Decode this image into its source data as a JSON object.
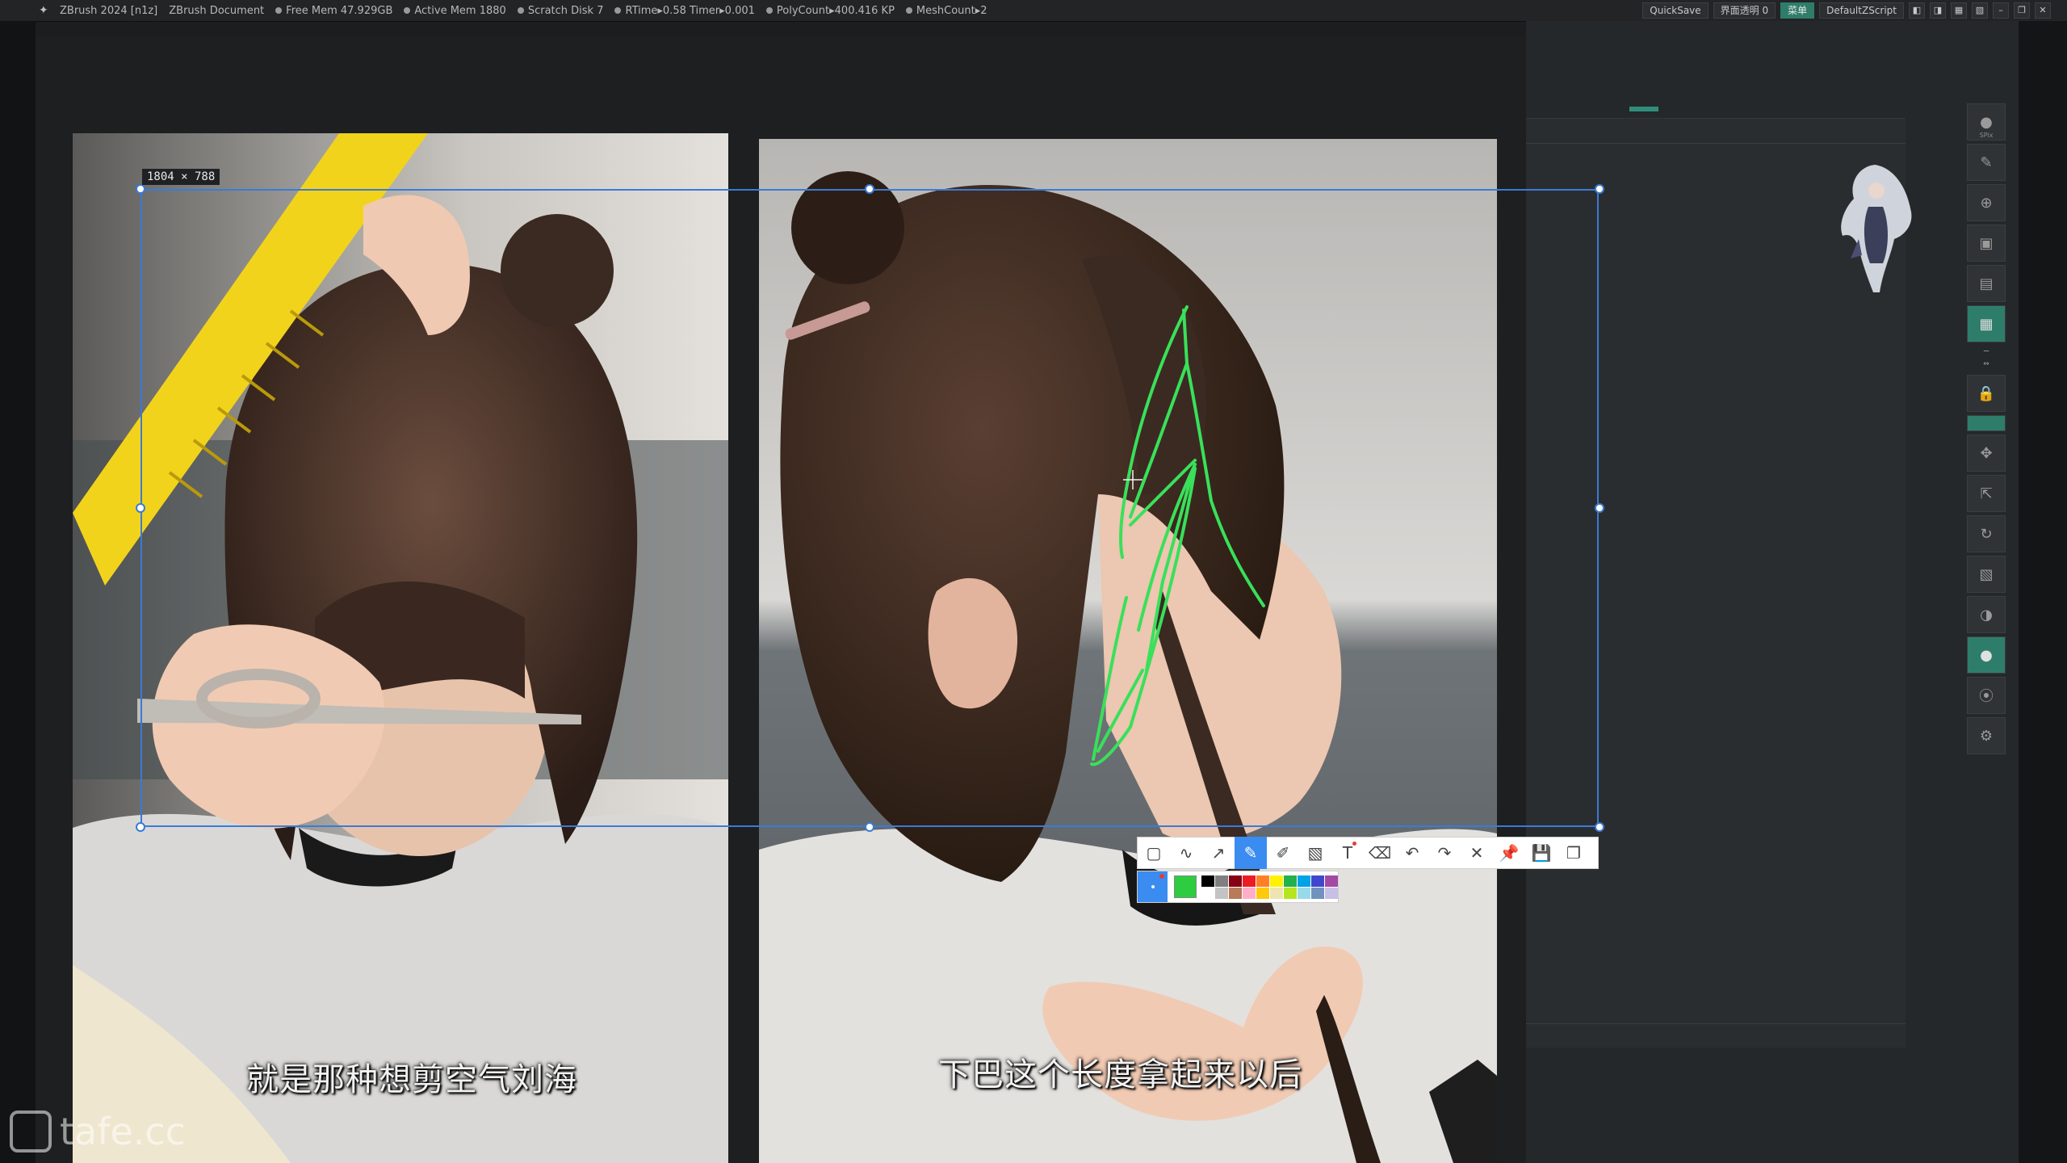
{
  "titlebar": {
    "app": "ZBrush 2024 [n1z]",
    "document": "ZBrush Document",
    "stats": [
      "Free Mem 47.929GB",
      "Active Mem 1880",
      "Scratch Disk 7",
      "RTime▸0.58 Timer▸0.001",
      "PolyCount▸400.416 KP",
      "MeshCount▸2"
    ],
    "quicksave": "QuickSave",
    "transparency": "界面透明 0",
    "menu_label": "菜单",
    "script": "DefaultZScript"
  },
  "capture": {
    "size_label": "1804 × 788"
  },
  "subtitles": {
    "left": "就是那种想剪空气刘海",
    "right": "下巴这个长度拿起来以后"
  },
  "annotation_tools": [
    {
      "name": "rectangle-tool",
      "icon": "▢"
    },
    {
      "name": "freehand-tool",
      "icon": "∿"
    },
    {
      "name": "arrow-tool",
      "icon": "↗"
    },
    {
      "name": "pen-tool",
      "icon": "✎"
    },
    {
      "name": "marker-tool",
      "icon": "✐"
    },
    {
      "name": "mosaic-tool",
      "icon": "▧"
    },
    {
      "name": "text-tool",
      "icon": "T"
    },
    {
      "name": "eraser-tool",
      "icon": "⌫"
    },
    {
      "name": "undo-button",
      "icon": "↶"
    },
    {
      "name": "redo-button",
      "icon": "↷"
    },
    {
      "name": "close-button",
      "icon": "✕"
    },
    {
      "name": "pin-button",
      "icon": "📌"
    },
    {
      "name": "save-button",
      "icon": "💾"
    },
    {
      "name": "copy-button",
      "icon": "❐"
    }
  ],
  "palette": {
    "current": "#2ecc40",
    "colors": [
      "#000000",
      "#7f7f7f",
      "#880015",
      "#ed1c24",
      "#ff7f27",
      "#fff200",
      "#22b14c",
      "#00a2e8",
      "#3f48cc",
      "#a349a4",
      "#ffffff",
      "#c3c3c3",
      "#b97a57",
      "#ffaec9",
      "#ffc90e",
      "#efe4b0",
      "#b5e61d",
      "#99d9ea",
      "#7092be",
      "#c8bfe7"
    ]
  },
  "watermark": "tafe.cc",
  "colors": {
    "selection": "#3a7bd5",
    "annotation": "#39e05a",
    "accent": "#2e7d6b"
  }
}
